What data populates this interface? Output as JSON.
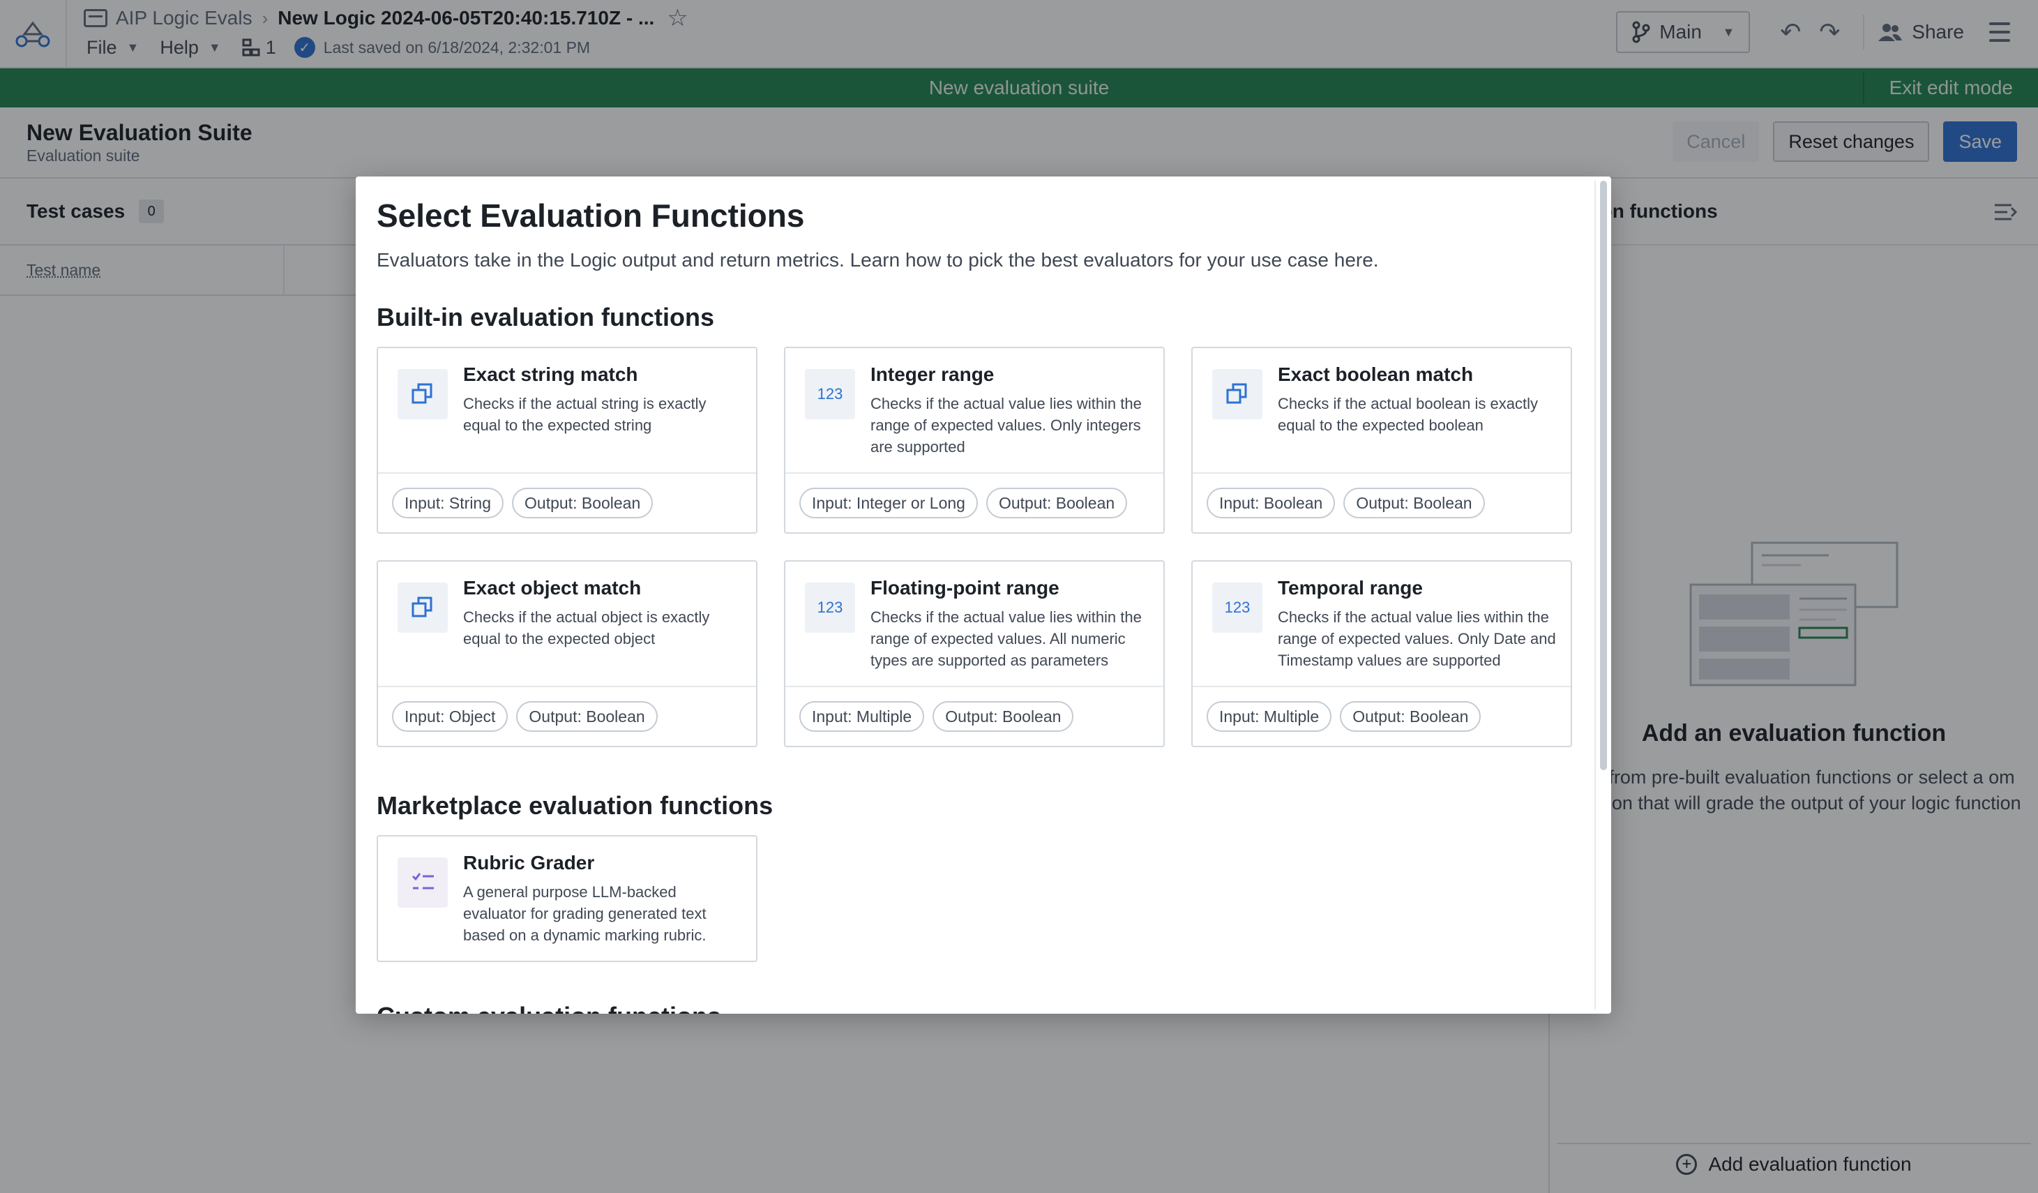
{
  "header": {
    "app_name": "AIP Logic Evals",
    "doc_title": "New Logic 2024-06-05T20:40:15.710Z - ...",
    "menus": [
      "File",
      "Help"
    ],
    "tree_count": "1",
    "saved_status": "Last saved on 6/18/2024, 2:32:01 PM",
    "branch": "Main",
    "share": "Share"
  },
  "banner": {
    "text": "New evaluation suite",
    "exit": "Exit edit mode",
    "color": "#238551"
  },
  "suite": {
    "title": "New Evaluation Suite",
    "subtitle": "Evaluation suite",
    "cancel": "Cancel",
    "reset": "Reset changes",
    "save": "Save"
  },
  "test_cases": {
    "title": "Test cases",
    "count": "0",
    "column": "Test name"
  },
  "eval_panel": {
    "title": "ation functions",
    "empty_title": "Add an evaluation function",
    "empty_desc": "ose from pre-built evaluation functions or select a om function that will grade the output of your logic function",
    "add_button": "Add evaluation function"
  },
  "modal": {
    "title": "Select Evaluation Functions",
    "description": "Evaluators take in the Logic output and return metrics. Learn how to pick the best evaluators for your use case here.",
    "builtin_title": "Built-in evaluation functions",
    "builtin": [
      {
        "name": "Exact string match",
        "desc": "Checks if the actual string is exactly equal to the expected string",
        "icon": "copy-icon",
        "input": "Input: String",
        "output": "Output: Boolean"
      },
      {
        "name": "Integer range",
        "desc": "Checks if the actual value lies within the range of expected values. Only integers are supported",
        "icon": "numeric-icon",
        "input": "Input: Integer or Long",
        "output": "Output: Boolean"
      },
      {
        "name": "Exact boolean match",
        "desc": "Checks if the actual boolean is exactly equal to the expected boolean",
        "icon": "copy-icon",
        "input": "Input: Boolean",
        "output": "Output: Boolean"
      },
      {
        "name": "Exact object match",
        "desc": "Checks if the actual object is exactly equal to the expected object",
        "icon": "copy-icon",
        "input": "Input: Object",
        "output": "Output: Boolean"
      },
      {
        "name": "Floating-point range",
        "desc": "Checks if the actual value lies within the range of expected values. All numeric types are supported as parameters",
        "icon": "numeric-icon",
        "input": "Input: Multiple",
        "output": "Output: Boolean"
      },
      {
        "name": "Temporal range",
        "desc": "Checks if the actual value lies within the range of expected values. Only Date and Timestamp values are supported",
        "icon": "numeric-icon",
        "input": "Input: Multiple",
        "output": "Output: Boolean"
      }
    ],
    "numeric_glyph": "123",
    "marketplace_title": "Marketplace evaluation functions",
    "marketplace": [
      {
        "name": "Rubric Grader",
        "desc": "A general purpose LLM-backed evaluator for grading generated text based on a dynamic marking rubric.",
        "icon": "checklist-icon"
      }
    ],
    "custom_title": "Custom evaluation functions"
  }
}
